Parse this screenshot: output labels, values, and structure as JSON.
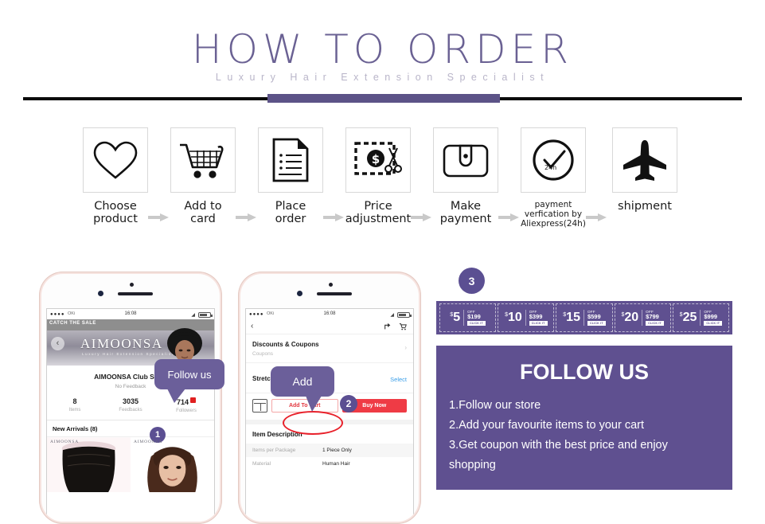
{
  "header": {
    "title": "HOW TO ORDER",
    "subtitle": "Luxury Hair Extension Specialist"
  },
  "steps": [
    {
      "icon": "heart-icon",
      "label_line1": "Choose",
      "label_line2": "product"
    },
    {
      "icon": "cart-icon",
      "label_line1": "Add to",
      "label_line2": "card"
    },
    {
      "icon": "document-icon",
      "label_line1": "Place",
      "label_line2": "order"
    },
    {
      "icon": "price-cut-icon",
      "label_line1": "Price",
      "label_line2": "adjustment"
    },
    {
      "icon": "wallet-icon",
      "label_line1": "Make",
      "label_line2": "payment"
    },
    {
      "icon": "clock-check-icon",
      "label_line1": "payment",
      "label_line2": "verfication by",
      "label_line3": "Aliexpress(24h)",
      "badge": "24h"
    },
    {
      "icon": "airplane-icon",
      "label_line1": "shipment",
      "label_line2": ""
    }
  ],
  "phone1": {
    "status": {
      "dots": "●●●●",
      "carrier": "OKi",
      "time": "16:08",
      "wifi": "◢"
    },
    "sale_banner": "CATCH THE SALE",
    "back_icon": "‹",
    "logo": "AIMOONSA",
    "logo_sub": "Luxury Hair Extension Specialist",
    "store_name": "AIMOONSA Club Store",
    "feedback": "No Feedback",
    "stats": [
      {
        "value": "8",
        "label": "Items"
      },
      {
        "value": "3035",
        "label": "Feedbacks"
      },
      {
        "value": "714",
        "label": "Followers",
        "badge": true
      }
    ],
    "new_arrivals": "New Arrivals (8)",
    "product_labels": [
      "AIMOONSA",
      "AIMOONSA"
    ],
    "bubble": "Follow us",
    "badge": "1"
  },
  "phone2": {
    "status": {
      "dots": "●●●●",
      "carrier": "OKi",
      "time": "16:08",
      "wifi": "◢"
    },
    "back_icon": "‹",
    "share_icon": "↱",
    "cart_icon": "Ὥ2",
    "rows": [
      {
        "title": "Discounts & Coupons",
        "sub": "Coupons",
        "chevron": "›"
      },
      {
        "title": "Stretched Length",
        "action": "Select"
      }
    ],
    "add_to_cart": "Add To Cart",
    "buy_now": "Buy Now",
    "description_title": "Item Description",
    "description_rows": [
      {
        "key": "Items per Package",
        "value": "1 Piece Only"
      },
      {
        "key": "Material",
        "value": "Human Hair"
      }
    ],
    "bubble": "Add",
    "badge": "2"
  },
  "right_panel": {
    "badge": "3",
    "coupons": [
      {
        "amount": "5",
        "currency": "$",
        "off": "OFF",
        "min": "$199",
        "cta": "CLICK IT"
      },
      {
        "amount": "10",
        "currency": "$",
        "off": "OFF",
        "min": "$399",
        "cta": "CLICK IT"
      },
      {
        "amount": "15",
        "currency": "$",
        "off": "OFF",
        "min": "$599",
        "cta": "CLICK IT"
      },
      {
        "amount": "20",
        "currency": "$",
        "off": "OFF",
        "min": "$799",
        "cta": "CLICK IT"
      },
      {
        "amount": "25",
        "currency": "$",
        "off": "OFF",
        "min": "$999",
        "cta": "CLICK IT"
      }
    ],
    "follow_title": "FOLLOW US",
    "follow_items": [
      "1.Follow our store",
      "2.Add your favourite items to your cart",
      "3.Get coupon with the best price and enjoy",
      "shopping"
    ]
  },
  "colors": {
    "brand_purple": "#5f5090",
    "title_purple": "#6a6193",
    "bubble_purple": "#6b5f9a",
    "badge_purple": "#5b4f92",
    "accent_red": "#ef3b45",
    "rose_gold": "#f6e3df"
  }
}
